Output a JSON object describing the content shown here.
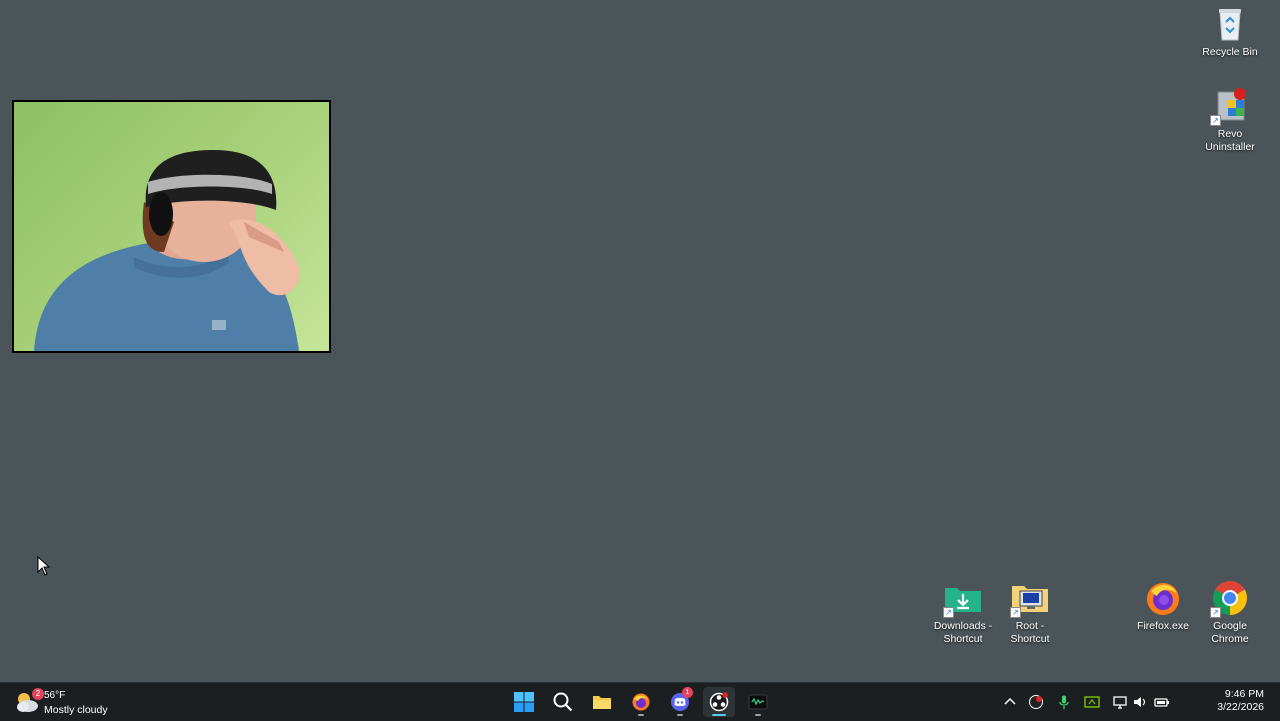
{
  "desktop": {
    "icons": {
      "recycle_bin": "Recycle Bin",
      "revo_line1": "Revo",
      "revo_line2": "Uninstaller",
      "downloads_line1": "Downloads -",
      "downloads_line2": "Shortcut",
      "root_line1": "Root -",
      "root_line2": "Shortcut",
      "firefox": "Firefox.exe",
      "chrome_line1": "Google",
      "chrome_line2": "Chrome"
    }
  },
  "webcam": {
    "description_icon": "webcam-feed"
  },
  "taskbar": {
    "weather": {
      "temp": "56°F",
      "condition": "Mostly cloudy",
      "badge": "2"
    },
    "pinned": [
      "start",
      "search",
      "file-explorer",
      "firefox",
      "discord",
      "obs",
      "terminal"
    ],
    "discord_badge": "1",
    "clock": {
      "time": "9:46 PM",
      "date": "3/22/2026"
    }
  },
  "colors": {
    "desktop_bg": "#4b5559",
    "taskbar_bg": "#1c1f22",
    "accent": "#58c9e6"
  }
}
